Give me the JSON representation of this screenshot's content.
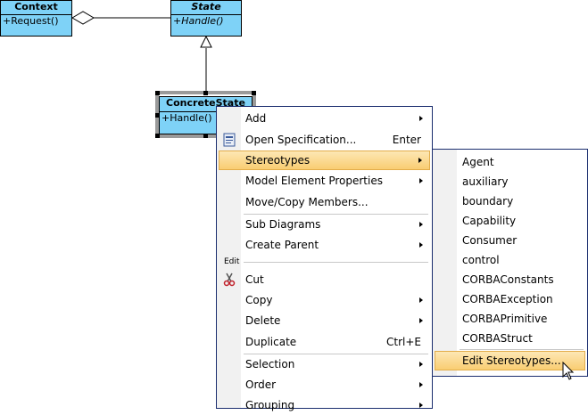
{
  "diagram": {
    "context": {
      "name": "Context",
      "operation": "+Request()"
    },
    "state": {
      "name": "State",
      "operation": "+Handle()"
    },
    "concrete": {
      "name": "ConcreteState",
      "operation": "+Handle()"
    }
  },
  "context_menu": {
    "items": [
      {
        "label": "Add",
        "submenu": true
      },
      {
        "label": "Open Specification...",
        "shortcut": "Enter",
        "icon": "specification-icon"
      },
      {
        "label": "Stereotypes",
        "submenu": true,
        "highlighted": true
      },
      {
        "label": "Model Element Properties",
        "submenu": true
      },
      {
        "label": "Move/Copy Members..."
      },
      {
        "label": "Sub Diagrams",
        "submenu": true
      },
      {
        "label": "Create Parent",
        "submenu": true
      },
      {
        "label": "Cut",
        "icon": "scissors-icon"
      },
      {
        "label": "Copy",
        "submenu": true
      },
      {
        "label": "Delete",
        "submenu": true
      },
      {
        "label": "Duplicate",
        "shortcut": "Ctrl+E"
      },
      {
        "label": "Selection",
        "submenu": true
      },
      {
        "label": "Order",
        "submenu": true
      },
      {
        "label": "Grouping",
        "submenu": true
      }
    ],
    "group_label": "Edit"
  },
  "stereotypes_menu": {
    "items": [
      "Agent",
      "auxiliary",
      "boundary",
      "Capability",
      "Consumer",
      "control",
      "CORBAConstants",
      "CORBAException",
      "CORBAPrimitive",
      "CORBAStruct"
    ],
    "edit_label": "Edit Stereotypes..."
  },
  "colors": {
    "class_fill": "#7ed2f7",
    "menu_border": "#1a2d6e",
    "highlight": "#f9cd72"
  }
}
